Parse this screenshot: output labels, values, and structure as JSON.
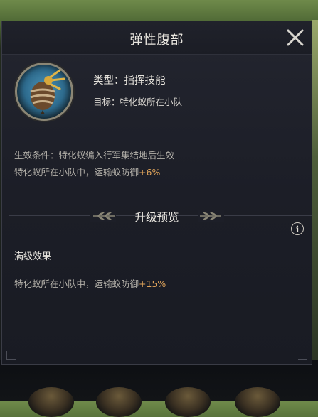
{
  "dialog": {
    "title": "弹性腹部",
    "close_icon": "close-icon"
  },
  "skill": {
    "icon": "ant-abdomen-icon",
    "type_label": "类型：",
    "type_value": "指挥技能",
    "target_label": "目标：",
    "target_value": "特化蚁所在小队"
  },
  "current_effect": {
    "condition": "生效条件：特化蚁编入行军集结地后生效",
    "text_prefix": "特化蚁所在小队中，运输蚁防御",
    "value": "+6%"
  },
  "upgrade_preview": {
    "title": "升级预览",
    "info_icon": "info-icon",
    "max_level_label": "满级效果",
    "text_prefix": "特化蚁所在小队中，运输蚁防御",
    "value": "+15%"
  },
  "colors": {
    "highlight": "#e0a45b",
    "text_primary": "#e9e6df",
    "text_secondary": "#b3b0a9",
    "panel_bg": "#1c1e27"
  }
}
